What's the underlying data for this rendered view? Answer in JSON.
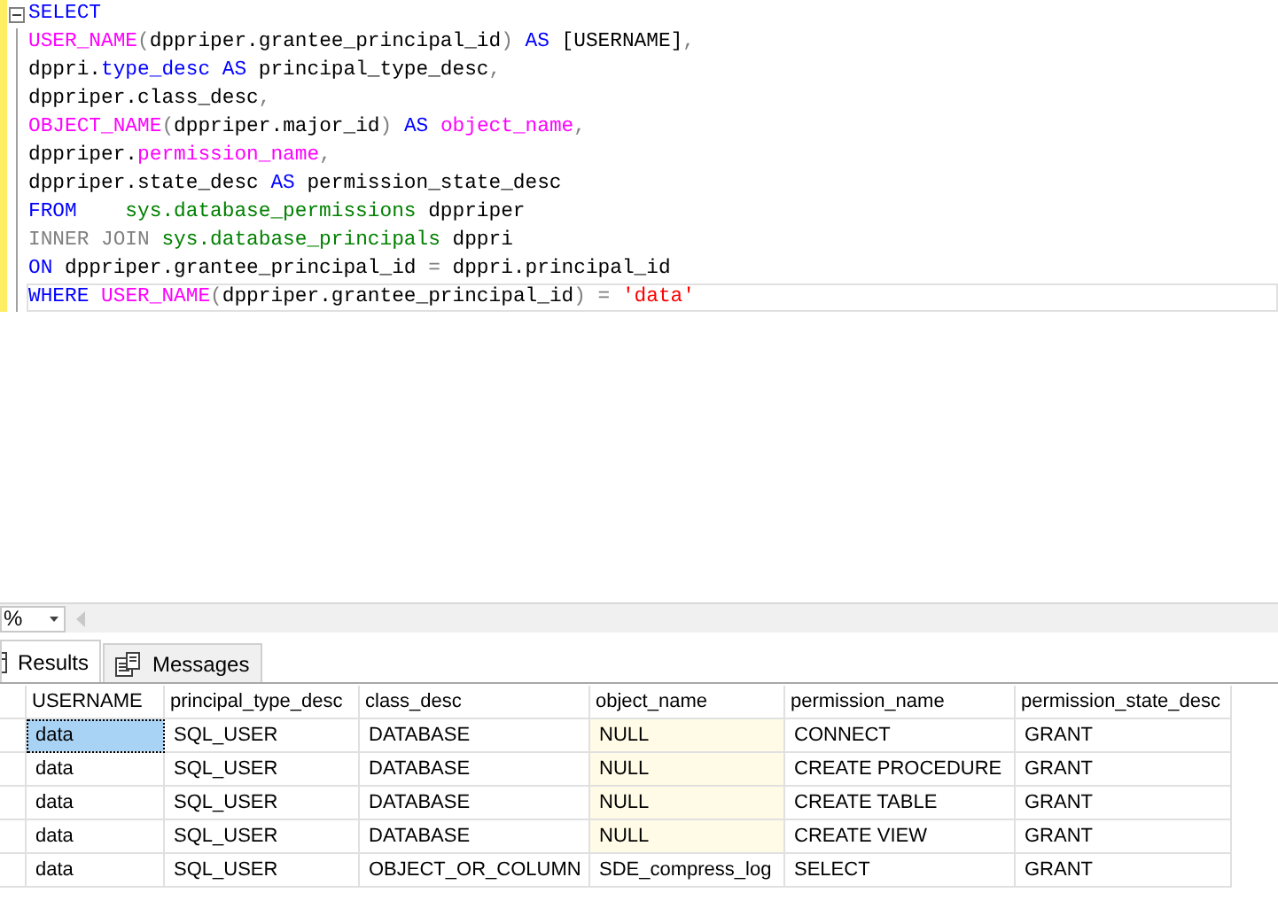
{
  "editor": {
    "lines": [
      {
        "current": false,
        "collapsible": true,
        "tokens": [
          {
            "kind": "keyword",
            "text": "SELECT"
          }
        ]
      },
      {
        "current": false,
        "collapsible": false,
        "tokens": [
          {
            "kind": "function",
            "text": "USER_NAME"
          },
          {
            "kind": "operator",
            "text": "("
          },
          {
            "kind": "plain",
            "text": "dppriper.grantee_principal_id"
          },
          {
            "kind": "operator",
            "text": ")"
          },
          {
            "kind": "keyword",
            "text": " AS "
          },
          {
            "kind": "plain",
            "text": "[USERNAME]"
          },
          {
            "kind": "operator",
            "text": ","
          }
        ]
      },
      {
        "current": false,
        "collapsible": false,
        "tokens": [
          {
            "kind": "plain",
            "text": "dppri."
          },
          {
            "kind": "keyword",
            "text": "type_desc"
          },
          {
            "kind": "keyword",
            "text": " AS "
          },
          {
            "kind": "plain",
            "text": "principal_type_desc"
          },
          {
            "kind": "operator",
            "text": ","
          }
        ]
      },
      {
        "current": false,
        "collapsible": false,
        "tokens": [
          {
            "kind": "plain",
            "text": "dppriper.class_desc"
          },
          {
            "kind": "operator",
            "text": ","
          }
        ]
      },
      {
        "current": false,
        "collapsible": false,
        "tokens": [
          {
            "kind": "function",
            "text": "OBJECT_NAME"
          },
          {
            "kind": "operator",
            "text": "("
          },
          {
            "kind": "plain",
            "text": "dppriper.major_id"
          },
          {
            "kind": "operator",
            "text": ")"
          },
          {
            "kind": "keyword",
            "text": " AS "
          },
          {
            "kind": "function",
            "text": "object_name"
          },
          {
            "kind": "operator",
            "text": ","
          }
        ]
      },
      {
        "current": false,
        "collapsible": false,
        "tokens": [
          {
            "kind": "plain",
            "text": "dppriper."
          },
          {
            "kind": "function",
            "text": "permission_name"
          },
          {
            "kind": "operator",
            "text": ","
          }
        ]
      },
      {
        "current": false,
        "collapsible": false,
        "tokens": [
          {
            "kind": "plain",
            "text": "dppriper.state_desc"
          },
          {
            "kind": "keyword",
            "text": " AS "
          },
          {
            "kind": "plain",
            "text": "permission_state_desc"
          }
        ]
      },
      {
        "current": false,
        "collapsible": false,
        "tokens": [
          {
            "kind": "keyword",
            "text": "FROM"
          },
          {
            "kind": "system",
            "text": "    sys.database_permissions"
          },
          {
            "kind": "plain",
            "text": " dppriper"
          }
        ]
      },
      {
        "current": false,
        "collapsible": false,
        "tokens": [
          {
            "kind": "operator",
            "text": "INNER JOIN"
          },
          {
            "kind": "system",
            "text": " sys.database_principals"
          },
          {
            "kind": "plain",
            "text": " dppri"
          }
        ]
      },
      {
        "current": false,
        "collapsible": false,
        "tokens": [
          {
            "kind": "keyword",
            "text": "ON"
          },
          {
            "kind": "plain",
            "text": " dppriper.grantee_principal_id "
          },
          {
            "kind": "operator",
            "text": "="
          },
          {
            "kind": "plain",
            "text": " dppri.principal_id"
          }
        ]
      },
      {
        "current": true,
        "collapsible": false,
        "tokens": [
          {
            "kind": "keyword",
            "text": "WHERE"
          },
          {
            "kind": "function",
            "text": " USER_NAME"
          },
          {
            "kind": "operator",
            "text": "("
          },
          {
            "kind": "plain",
            "text": "dppriper.grantee_principal_id"
          },
          {
            "kind": "operator",
            "text": ") = "
          },
          {
            "kind": "string",
            "text": "'data'"
          }
        ]
      }
    ]
  },
  "zoom": {
    "value": "%"
  },
  "tabs": [
    {
      "label": "Results",
      "selected": true
    },
    {
      "label": "Messages",
      "selected": false
    }
  ],
  "grid": {
    "columns": [
      "USERNAME",
      "principal_type_desc",
      "class_desc",
      "object_name",
      "permission_name",
      "permission_state_desc"
    ],
    "rows": [
      {
        "cells": [
          {
            "text": "data",
            "kind": "value",
            "selected": true
          },
          {
            "text": "SQL_USER",
            "kind": "value",
            "selected": false
          },
          {
            "text": "DATABASE",
            "kind": "value",
            "selected": false
          },
          {
            "text": "NULL",
            "kind": "null",
            "selected": false
          },
          {
            "text": "CONNECT",
            "kind": "value",
            "selected": false
          },
          {
            "text": "GRANT",
            "kind": "value",
            "selected": false
          }
        ]
      },
      {
        "cells": [
          {
            "text": "data",
            "kind": "value",
            "selected": false
          },
          {
            "text": "SQL_USER",
            "kind": "value",
            "selected": false
          },
          {
            "text": "DATABASE",
            "kind": "value",
            "selected": false
          },
          {
            "text": "NULL",
            "kind": "null",
            "selected": false
          },
          {
            "text": "CREATE PROCEDURE",
            "kind": "value",
            "selected": false
          },
          {
            "text": "GRANT",
            "kind": "value",
            "selected": false
          }
        ]
      },
      {
        "cells": [
          {
            "text": "data",
            "kind": "value",
            "selected": false
          },
          {
            "text": "SQL_USER",
            "kind": "value",
            "selected": false
          },
          {
            "text": "DATABASE",
            "kind": "value",
            "selected": false
          },
          {
            "text": "NULL",
            "kind": "null",
            "selected": false
          },
          {
            "text": "CREATE TABLE",
            "kind": "value",
            "selected": false
          },
          {
            "text": "GRANT",
            "kind": "value",
            "selected": false
          }
        ]
      },
      {
        "cells": [
          {
            "text": "data",
            "kind": "value",
            "selected": false
          },
          {
            "text": "SQL_USER",
            "kind": "value",
            "selected": false
          },
          {
            "text": "DATABASE",
            "kind": "value",
            "selected": false
          },
          {
            "text": "NULL",
            "kind": "null",
            "selected": false
          },
          {
            "text": "CREATE VIEW",
            "kind": "value",
            "selected": false
          },
          {
            "text": "GRANT",
            "kind": "value",
            "selected": false
          }
        ]
      },
      {
        "cells": [
          {
            "text": "data",
            "kind": "value",
            "selected": false
          },
          {
            "text": "SQL_USER",
            "kind": "value",
            "selected": false
          },
          {
            "text": "OBJECT_OR_COLUMN",
            "kind": "value",
            "selected": false
          },
          {
            "text": "SDE_compress_log",
            "kind": "value",
            "selected": false
          },
          {
            "text": "SELECT",
            "kind": "value",
            "selected": false
          },
          {
            "text": "GRANT",
            "kind": "value",
            "selected": false
          }
        ]
      }
    ]
  }
}
